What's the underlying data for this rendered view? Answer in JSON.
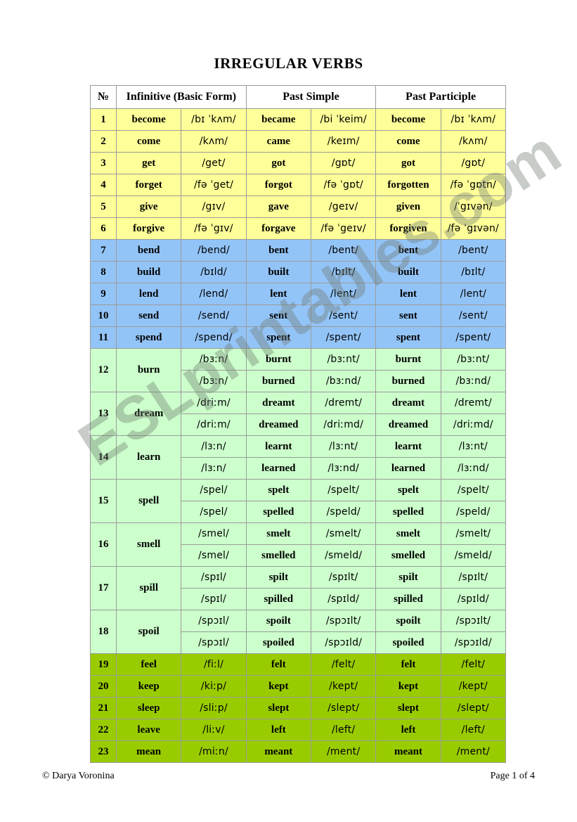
{
  "document": {
    "title": "IRREGULAR VERBS",
    "watermark": "ESLprintables.com"
  },
  "footer": {
    "copyright": "© Darya Voronina",
    "page_label": "Page 1 of 4"
  },
  "table": {
    "headers": {
      "number": "№",
      "infinitive": "Infinitive (Basic Form)",
      "past_simple": "Past Simple",
      "past_participle": "Past Participle"
    },
    "colors": {
      "yellow": "#ffff99",
      "blue": "#93c4f7",
      "light_green": "#ccffcc",
      "green": "#99cc00",
      "border": "#9b9b9b"
    },
    "rows": [
      {
        "n": "1",
        "group": "yellow",
        "infinitive": "become",
        "inf_ipa": "/bɪ ˈkʌm/",
        "past": "became",
        "past_ipa": "/bi ˈkeim/",
        "pp": "become",
        "pp_ipa": "/bɪ ˈkʌm/"
      },
      {
        "n": "2",
        "group": "yellow",
        "infinitive": "come",
        "inf_ipa": "/kʌm/",
        "past": "came",
        "past_ipa": "/keɪm/",
        "pp": "come",
        "pp_ipa": "/kʌm/"
      },
      {
        "n": "3",
        "group": "yellow",
        "infinitive": "get",
        "inf_ipa": "/get/",
        "past": "got",
        "past_ipa": "/gɒt/",
        "pp": "got",
        "pp_ipa": "/gɒt/"
      },
      {
        "n": "4",
        "group": "yellow",
        "infinitive": "forget",
        "inf_ipa": "/fə ˈget/",
        "past": "forgot",
        "past_ipa": "/fə ˈgɒt/",
        "pp": "forgotten",
        "pp_ipa": "/fə ˈgɒtn/"
      },
      {
        "n": "5",
        "group": "yellow",
        "infinitive": "give",
        "inf_ipa": "/gɪv/",
        "past": "gave",
        "past_ipa": "/geɪv/",
        "pp": "given",
        "pp_ipa": "/ˈgɪvən/"
      },
      {
        "n": "6",
        "group": "yellow",
        "infinitive": "forgive",
        "inf_ipa": "/fə ˈgɪv/",
        "past": "forgave",
        "past_ipa": "/fə ˈgeɪv/",
        "pp": "forgiven",
        "pp_ipa": "/fə ˈgɪvən/"
      },
      {
        "n": "7",
        "group": "blue",
        "infinitive": "bend",
        "inf_ipa": "/bend/",
        "past": "bent",
        "past_ipa": "/bent/",
        "pp": "bent",
        "pp_ipa": "/bent/"
      },
      {
        "n": "8",
        "group": "blue",
        "infinitive": "build",
        "inf_ipa": "/bɪld/",
        "past": "built",
        "past_ipa": "/bɪlt/",
        "pp": "built",
        "pp_ipa": "/bɪlt/"
      },
      {
        "n": "9",
        "group": "blue",
        "infinitive": "lend",
        "inf_ipa": "/lend/",
        "past": "lent",
        "past_ipa": "/lent/",
        "pp": "lent",
        "pp_ipa": "/lent/"
      },
      {
        "n": "10",
        "group": "blue",
        "infinitive": "send",
        "inf_ipa": "/send/",
        "past": "sent",
        "past_ipa": "/sent/",
        "pp": "sent",
        "pp_ipa": "/sent/"
      },
      {
        "n": "11",
        "group": "blue",
        "infinitive": "spend",
        "inf_ipa": "/spend/",
        "past": "spent",
        "past_ipa": "/spent/",
        "pp": "spent",
        "pp_ipa": "/spent/"
      },
      {
        "n": "12",
        "group": "light_green",
        "infinitive": "burn",
        "variants": [
          {
            "inf_ipa": "/bɜːn/",
            "past": "burnt",
            "past_ipa": "/bɜːnt/",
            "pp": "burnt",
            "pp_ipa": "/bɜːnt/"
          },
          {
            "inf_ipa": "/bɜːn/",
            "past": "burned",
            "past_ipa": "/bɜːnd/",
            "pp": "burned",
            "pp_ipa": "/bɜːnd/"
          }
        ]
      },
      {
        "n": "13",
        "group": "light_green",
        "infinitive": "dream",
        "variants": [
          {
            "inf_ipa": "/driːm/",
            "past": "dreamt",
            "past_ipa": "/dremt/",
            "pp": "dreamt",
            "pp_ipa": "/dremt/"
          },
          {
            "inf_ipa": "/driːm/",
            "past": "dreamed",
            "past_ipa": "/driːmd/",
            "pp": "dreamed",
            "pp_ipa": "/driːmd/"
          }
        ]
      },
      {
        "n": "14",
        "group": "light_green",
        "infinitive": "learn",
        "variants": [
          {
            "inf_ipa": "/lɜːn/",
            "past": "learnt",
            "past_ipa": "/lɜːnt/",
            "pp": "learnt",
            "pp_ipa": "/lɜːnt/"
          },
          {
            "inf_ipa": "/lɜːn/",
            "past": "learned",
            "past_ipa": "/lɜːnd/",
            "pp": "learned",
            "pp_ipa": "/lɜːnd/"
          }
        ]
      },
      {
        "n": "15",
        "group": "light_green",
        "infinitive": "spell",
        "variants": [
          {
            "inf_ipa": "/spel/",
            "past": "spelt",
            "past_ipa": "/spelt/",
            "pp": "spelt",
            "pp_ipa": "/spelt/"
          },
          {
            "inf_ipa": "/spel/",
            "past": "spelled",
            "past_ipa": "/speld/",
            "pp": "spelled",
            "pp_ipa": "/speld/"
          }
        ]
      },
      {
        "n": "16",
        "group": "light_green",
        "infinitive": "smell",
        "variants": [
          {
            "inf_ipa": "/smel/",
            "past": "smelt",
            "past_ipa": "/smelt/",
            "pp": "smelt",
            "pp_ipa": "/smelt/"
          },
          {
            "inf_ipa": "/smel/",
            "past": "smelled",
            "past_ipa": "/smeld/",
            "pp": "smelled",
            "pp_ipa": "/smeld/"
          }
        ]
      },
      {
        "n": "17",
        "group": "light_green",
        "infinitive": "spill",
        "variants": [
          {
            "inf_ipa": "/spɪl/",
            "past": "spilt",
            "past_ipa": "/spɪlt/",
            "pp": "spilt",
            "pp_ipa": "/spɪlt/"
          },
          {
            "inf_ipa": "/spɪl/",
            "past": "spilled",
            "past_ipa": "/spɪld/",
            "pp": "spilled",
            "pp_ipa": "/spɪld/"
          }
        ]
      },
      {
        "n": "18",
        "group": "light_green",
        "infinitive": "spoil",
        "variants": [
          {
            "inf_ipa": "/spɔɪl/",
            "past": "spoilt",
            "past_ipa": "/spɔɪlt/",
            "pp": "spoilt",
            "pp_ipa": "/spɔɪlt/"
          },
          {
            "inf_ipa": "/spɔɪl/",
            "past": "spoiled",
            "past_ipa": "/spɔɪld/",
            "pp": "spoiled",
            "pp_ipa": "/spɔɪld/"
          }
        ]
      },
      {
        "n": "19",
        "group": "green",
        "infinitive": "feel",
        "inf_ipa": "/fiːl/",
        "past": "felt",
        "past_ipa": "/felt/",
        "pp": "felt",
        "pp_ipa": "/felt/"
      },
      {
        "n": "20",
        "group": "green",
        "infinitive": "keep",
        "inf_ipa": "/kiːp/",
        "past": "kept",
        "past_ipa": "/kept/",
        "pp": "kept",
        "pp_ipa": "/kept/"
      },
      {
        "n": "21",
        "group": "green",
        "infinitive": "sleep",
        "inf_ipa": "/sliːp/",
        "past": "slept",
        "past_ipa": "/slept/",
        "pp": "slept",
        "pp_ipa": "/slept/"
      },
      {
        "n": "22",
        "group": "green",
        "infinitive": "leave",
        "inf_ipa": "/liːv/",
        "past": "left",
        "past_ipa": "/left/",
        "pp": "left",
        "pp_ipa": "/left/"
      },
      {
        "n": "23",
        "group": "green",
        "infinitive": "mean",
        "inf_ipa": "/miːn/",
        "past": "meant",
        "past_ipa": "/ment/",
        "pp": "meant",
        "pp_ipa": "/ment/"
      }
    ]
  }
}
